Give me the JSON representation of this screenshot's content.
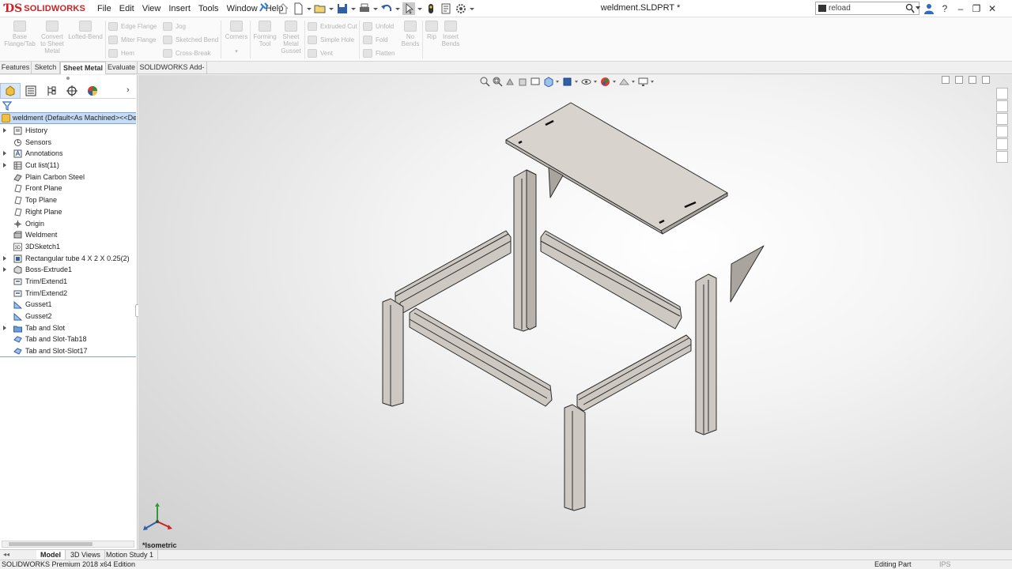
{
  "app": {
    "brand": "SOLIDWORKS",
    "document_title": "weldment.SLDPRT *"
  },
  "menu": [
    "File",
    "Edit",
    "View",
    "Insert",
    "Tools",
    "Window",
    "Help"
  ],
  "search": {
    "value": "reload"
  },
  "ribbon": {
    "buttons_large": [
      {
        "label": "Base\nFlange/Tab"
      },
      {
        "label": "Convert\nto Sheet\nMetal"
      },
      {
        "label": "Lofted-Bend"
      },
      {
        "label": "Corners"
      },
      {
        "label": "Forming\nTool"
      },
      {
        "label": "Sheet\nMetal\nGusset"
      },
      {
        "label": "No\nBends"
      },
      {
        "label": "Rip"
      },
      {
        "label": "Insert\nBends"
      }
    ],
    "buttons_small": [
      "Edge Flange",
      "Miter Flange",
      "Hem",
      "Jog",
      "Sketched Bend",
      "Cross-Break",
      "Extruded Cut",
      "Simple Hole",
      "Vent",
      "Unfold",
      "Fold",
      "Flatten"
    ]
  },
  "tabs": [
    "Features",
    "Sketch",
    "Sheet Metal",
    "Evaluate",
    "SOLIDWORKS Add-Ins"
  ],
  "tree": {
    "root": "weldment  (Default<As Machined><<Default>_",
    "items": [
      {
        "label": "History",
        "expandable": true,
        "icon": "history-icon"
      },
      {
        "label": "Sensors",
        "expandable": false,
        "icon": "sensors-icon"
      },
      {
        "label": "Annotations",
        "expandable": true,
        "icon": "annotations-icon"
      },
      {
        "label": "Cut list(11)",
        "expandable": true,
        "icon": "cut-list-icon"
      },
      {
        "label": "Plain Carbon Steel",
        "expandable": false,
        "icon": "material-icon"
      },
      {
        "label": "Front Plane",
        "expandable": false,
        "icon": "plane-icon"
      },
      {
        "label": "Top Plane",
        "expandable": false,
        "icon": "plane-icon"
      },
      {
        "label": "Right Plane",
        "expandable": false,
        "icon": "plane-icon"
      },
      {
        "label": "Origin",
        "expandable": false,
        "icon": "origin-icon"
      },
      {
        "label": "Weldment",
        "expandable": false,
        "icon": "weldment-icon"
      },
      {
        "label": "3DSketch1",
        "expandable": false,
        "icon": "3d-sketch-icon"
      },
      {
        "label": "Rectangular tube 4 X 2 X 0.25(2)",
        "expandable": true,
        "icon": "structural-member-icon"
      },
      {
        "label": "Boss-Extrude1",
        "expandable": true,
        "icon": "extrude-icon"
      },
      {
        "label": "Trim/Extend1",
        "expandable": false,
        "icon": "trim-extend-icon"
      },
      {
        "label": "Trim/Extend2",
        "expandable": false,
        "icon": "trim-extend-icon"
      },
      {
        "label": "Gusset1",
        "expandable": false,
        "icon": "gusset-icon"
      },
      {
        "label": "Gusset2",
        "expandable": false,
        "icon": "gusset-icon"
      },
      {
        "label": "Tab and Slot",
        "expandable": true,
        "icon": "folder-icon"
      },
      {
        "label": "Tab and Slot-Tab18",
        "expandable": false,
        "icon": "tab-slot-icon"
      },
      {
        "label": "Tab and Slot-Slot17",
        "expandable": false,
        "icon": "tab-slot-icon"
      }
    ]
  },
  "viewport": {
    "view_name": "*Isometric"
  },
  "bottom_tabs": [
    "Model",
    "3D Views",
    "Motion Study 1"
  ],
  "status": {
    "edition": "SOLIDWORKS Premium 2018 x64 Edition",
    "mode": "Editing Part",
    "units": "IPS"
  },
  "colors": {
    "brand_red": "#d02024",
    "selection_blue": "#c6dcf5",
    "part_face": "#d6d2cc"
  }
}
